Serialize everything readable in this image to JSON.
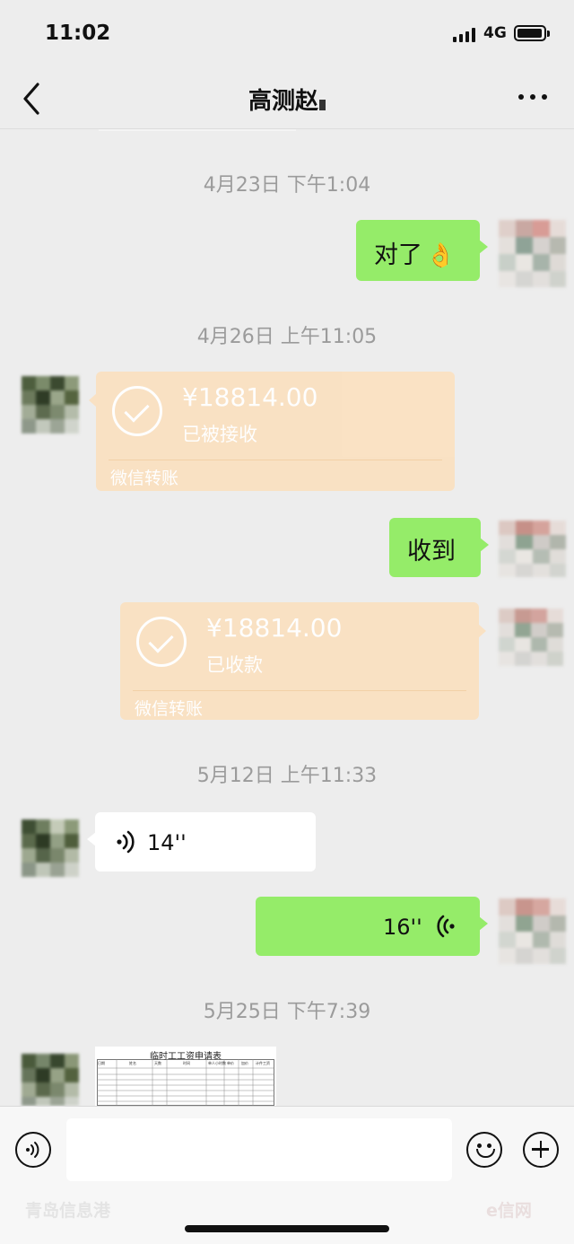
{
  "status_bar": {
    "time": "11:02",
    "network": "4G"
  },
  "nav": {
    "title": "高测赵"
  },
  "messages": {
    "t1": "4月23日 下午1:04",
    "m1_text": "对了",
    "m1_emoji": "👌",
    "t2": "4月26日 上午11:05",
    "transfer1": {
      "amount": "¥18814.00",
      "status": "已被接收",
      "label": "微信转账"
    },
    "m2_text": "收到",
    "transfer2": {
      "amount": "¥18814.00",
      "status": "已收款",
      "label": "微信转账"
    },
    "t3": "5月12日 上午11:33",
    "voice1": "14''",
    "voice2": "16''",
    "t4": "5月25日 下午7:39",
    "image": {
      "caption": "临时工工资申请表",
      "headers": [
        "日期",
        "姓名",
        "天数",
        "时间",
        "单人小时数",
        "单价",
        "加价",
        "计件工资"
      ]
    }
  },
  "watermark": {
    "left": "青岛信息港",
    "right": "e信网"
  },
  "icons": [
    "back-icon",
    "more-icon",
    "voice-icon",
    "emoji-icon",
    "plus-icon"
  ]
}
